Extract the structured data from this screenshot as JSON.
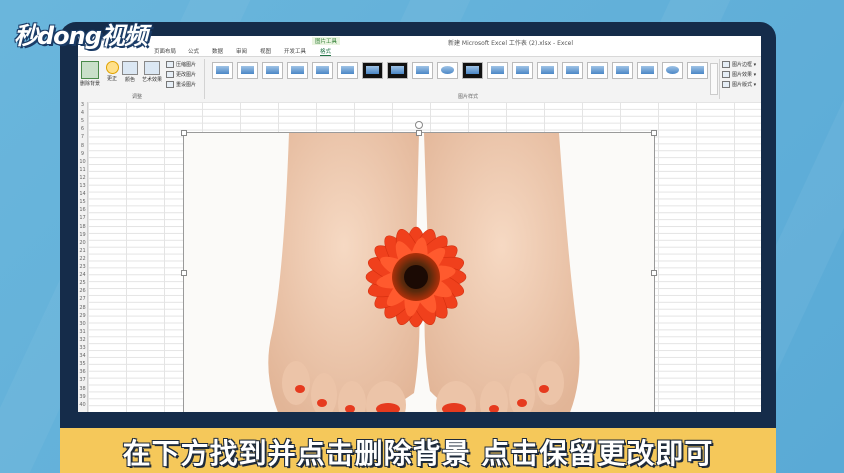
{
  "watermark": {
    "logo_text": "秒dong视频"
  },
  "window": {
    "title": "新建 Microsoft Excel 工作表 (2).xlsx - Excel",
    "context_tab_group": "图片工具"
  },
  "ribbon": {
    "tabs": [
      {
        "label": "页面布局",
        "active": false
      },
      {
        "label": "公式",
        "active": false
      },
      {
        "label": "数据",
        "active": false
      },
      {
        "label": "审阅",
        "active": false
      },
      {
        "label": "视图",
        "active": false
      },
      {
        "label": "开发工具",
        "active": false
      },
      {
        "label": "格式",
        "active": true
      }
    ],
    "adjust_group": {
      "remove_bg": "删除背景",
      "corrections": "更正",
      "color": "颜色",
      "artistic_effects": "艺术效果",
      "compress": "压缩图片",
      "change": "更改图片",
      "reset": "重设图片",
      "label": "调整"
    },
    "styles_group": {
      "label": "图片样式",
      "thumb_count": 18
    },
    "side_options": {
      "border": "图片边框 ▾",
      "effects": "图片效果 ▾",
      "layout": "图片版式 ▾"
    }
  },
  "sheet": {
    "row_numbers": [
      "3",
      "4",
      "5",
      "6",
      "7",
      "8",
      "9",
      "10",
      "11",
      "12",
      "13",
      "14",
      "15",
      "16",
      "17",
      "18",
      "19",
      "20",
      "21",
      "22",
      "23",
      "24",
      "25",
      "26",
      "27",
      "28",
      "29",
      "30",
      "31",
      "32",
      "33",
      "34",
      "35",
      "36",
      "37",
      "38",
      "39",
      "40"
    ]
  },
  "picture": {
    "subject": "feet with red gerbera flower"
  },
  "subtitle": {
    "text": "在下方找到并点击删除背景 点击保留更改即可"
  },
  "colors": {
    "accent": "#217346",
    "subtitle_bar": "#f5c85a",
    "frame": "#152c4a",
    "background": "#5aaad6"
  }
}
